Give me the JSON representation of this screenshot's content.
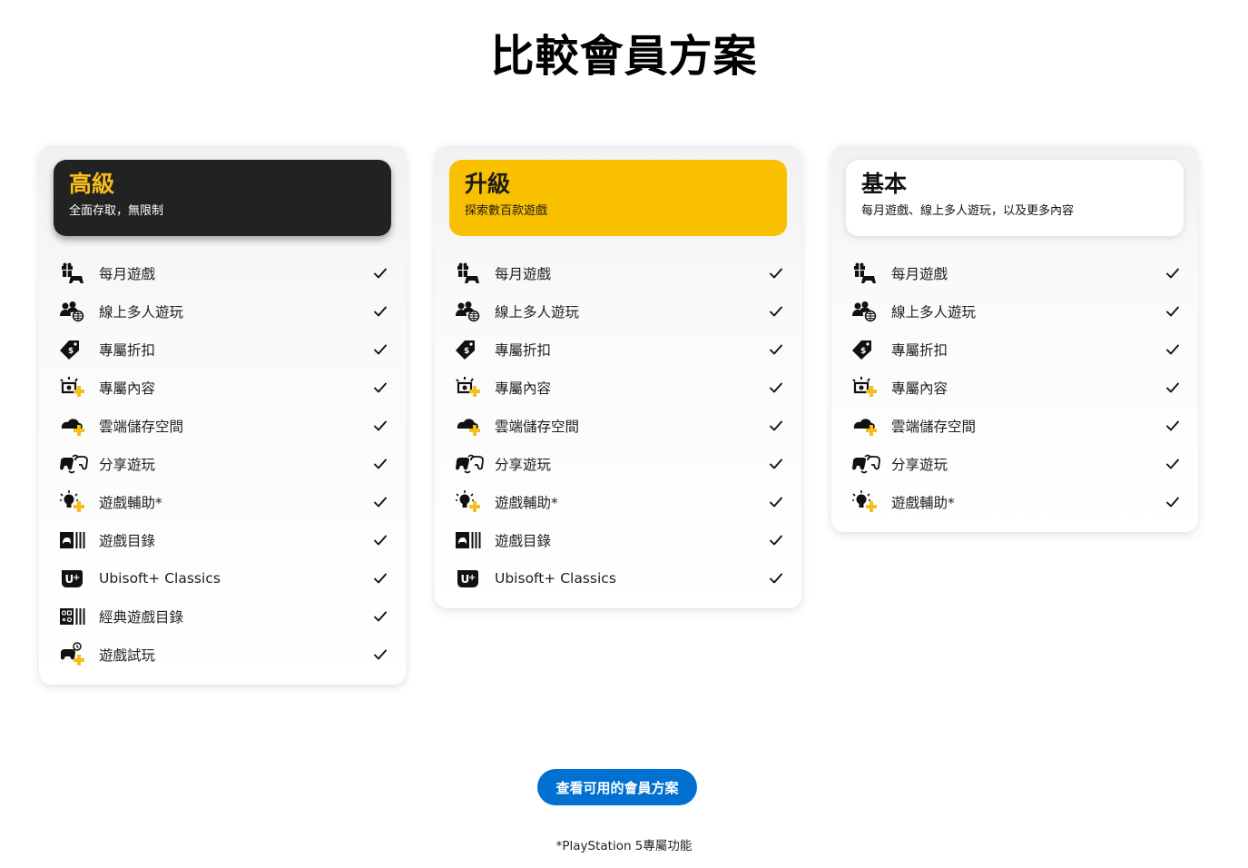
{
  "page": {
    "title": "比較會員方案"
  },
  "plans": [
    {
      "name": "高級",
      "subtitle": "全面存取，無限制",
      "theme": "dark",
      "header_color": "#222222",
      "name_color": "#f5be1c",
      "features": [
        {
          "label": "每月遊戲",
          "icon": "monthly-games-icon",
          "included": true
        },
        {
          "label": "線上多人遊玩",
          "icon": "online-multiplayer-icon",
          "included": true
        },
        {
          "label": "專屬折扣",
          "icon": "discount-tag-icon",
          "included": true
        },
        {
          "label": "專屬內容",
          "icon": "exclusive-content-icon",
          "included": true
        },
        {
          "label": "雲端儲存空間",
          "icon": "cloud-storage-icon",
          "included": true
        },
        {
          "label": "分享遊玩",
          "icon": "share-play-icon",
          "included": true
        },
        {
          "label": "遊戲輔助*",
          "icon": "game-help-icon",
          "included": true
        },
        {
          "label": "遊戲目錄",
          "icon": "game-catalog-icon",
          "included": true
        },
        {
          "label": "Ubisoft+ Classics",
          "icon": "ubisoft-plus-icon",
          "included": true
        },
        {
          "label": "經典遊戲目錄",
          "icon": "classics-catalog-icon",
          "included": true
        },
        {
          "label": "遊戲試玩",
          "icon": "game-trials-icon",
          "included": true
        }
      ]
    },
    {
      "name": "升級",
      "subtitle": "探索數百款遊戲",
      "theme": "yellow",
      "header_color": "#f9c000",
      "features": [
        {
          "label": "每月遊戲",
          "icon": "monthly-games-icon",
          "included": true
        },
        {
          "label": "線上多人遊玩",
          "icon": "online-multiplayer-icon",
          "included": true
        },
        {
          "label": "專屬折扣",
          "icon": "discount-tag-icon",
          "included": true
        },
        {
          "label": "專屬內容",
          "icon": "exclusive-content-icon",
          "included": true
        },
        {
          "label": "雲端儲存空間",
          "icon": "cloud-storage-icon",
          "included": true
        },
        {
          "label": "分享遊玩",
          "icon": "share-play-icon",
          "included": true
        },
        {
          "label": "遊戲輔助*",
          "icon": "game-help-icon",
          "included": true
        },
        {
          "label": "遊戲目錄",
          "icon": "game-catalog-icon",
          "included": true
        },
        {
          "label": "Ubisoft+ Classics",
          "icon": "ubisoft-plus-icon",
          "included": true
        }
      ]
    },
    {
      "name": "基本",
      "subtitle": "每月遊戲、線上多人遊玩，以及更多內容",
      "theme": "white",
      "header_color": "#ffffff",
      "features": [
        {
          "label": "每月遊戲",
          "icon": "monthly-games-icon",
          "included": true
        },
        {
          "label": "線上多人遊玩",
          "icon": "online-multiplayer-icon",
          "included": true
        },
        {
          "label": "專屬折扣",
          "icon": "discount-tag-icon",
          "included": true
        },
        {
          "label": "專屬內容",
          "icon": "exclusive-content-icon",
          "included": true
        },
        {
          "label": "雲端儲存空間",
          "icon": "cloud-storage-icon",
          "included": true
        },
        {
          "label": "分享遊玩",
          "icon": "share-play-icon",
          "included": true
        },
        {
          "label": "遊戲輔助*",
          "icon": "game-help-icon",
          "included": true
        }
      ]
    }
  ],
  "cta": {
    "label": "查看可用的會員方案",
    "color": "#0070d1"
  },
  "footnote": "*PlayStation 5專屬功能",
  "colors": {
    "accent_plus": "#f5be1c",
    "check": "#111111"
  }
}
